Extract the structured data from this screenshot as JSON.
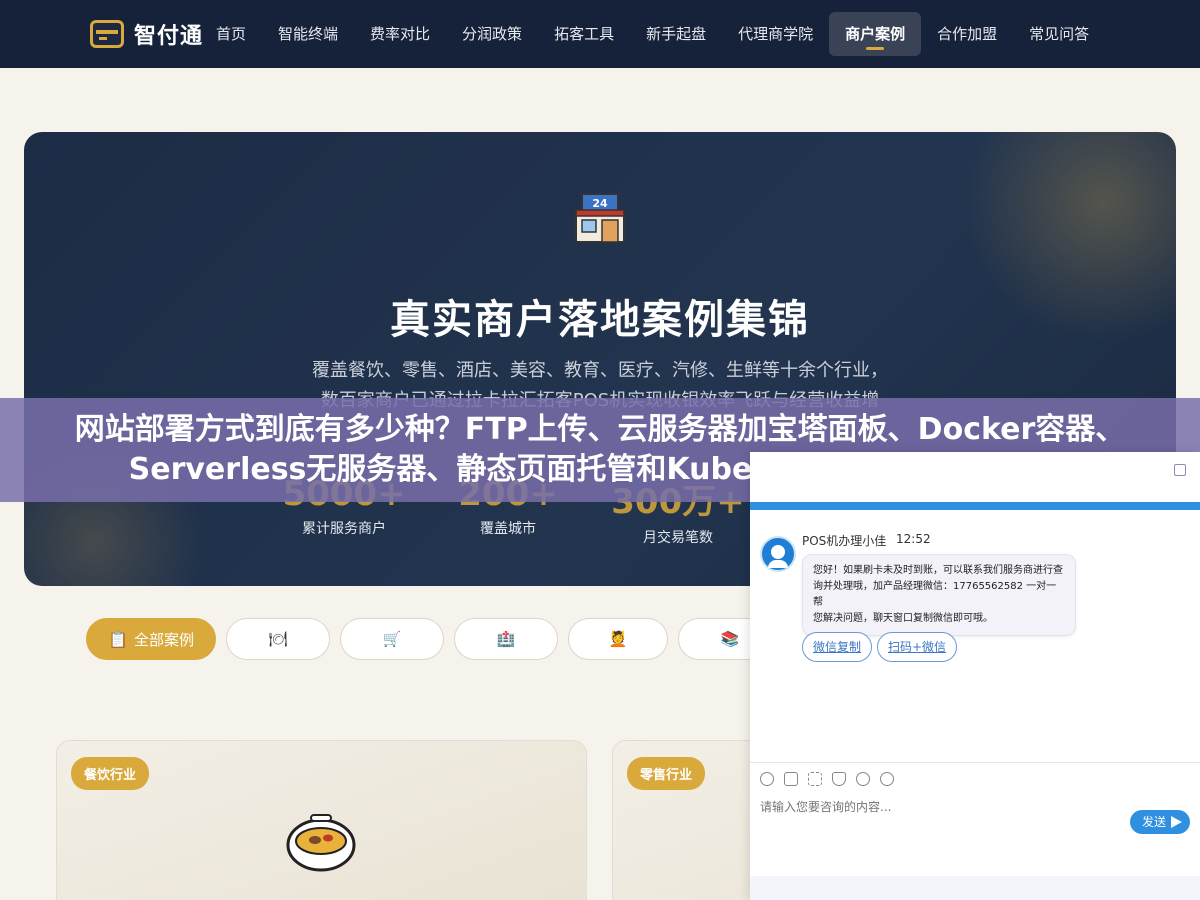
{
  "nav": {
    "brand": "智付通",
    "items": [
      "首页",
      "智能终端",
      "费率对比",
      "分润政策",
      "拓客工具",
      "新手起盘",
      "代理商学院",
      "商户案例",
      "合作加盟",
      "常见问答"
    ],
    "active": "商户案例"
  },
  "hero": {
    "icon": "convenience-store-icon",
    "title": "真实商户落地案例集锦",
    "desc_line1": "覆盖餐饮、零售、酒店、美容、教育、医疗、汽修、生鲜等十余个行业，",
    "desc_line2": "数百家商户已通过拉卡拉汇拓客POS机实现收银效率飞跃与经营收益增",
    "stats": [
      {
        "value": "5000+",
        "label": "累计服务商户"
      },
      {
        "value": "200+",
        "label": "覆盖城市"
      },
      {
        "value": "300万+",
        "label": "月交易笔数"
      }
    ]
  },
  "banner": {
    "text": "网站部署方式到底有多少种？FTP上传、云服务器加宝塔面板、Docker容器、Serverless无服务器、静态页面托管和Kubernetes这六种从省事到"
  },
  "filters": {
    "all_label": "全部案例",
    "all_icon": "clipboard-icon",
    "icons": [
      "dining-icon",
      "cart-icon",
      "hospital-icon",
      "beauty-icon",
      "books-icon"
    ]
  },
  "cards": [
    {
      "tag": "餐饮行业",
      "icon": "food-bowl-icon"
    },
    {
      "tag": "零售行业",
      "icon": ""
    }
  ],
  "chat": {
    "agent_name": "POS机办理小佳",
    "time": "12:52",
    "message_line1": "您好！如果刷卡未及时到账，可以联系我们服务商进行查",
    "message_line2": "询并处理哦，加产品经理微信：17765562582 一对一帮",
    "message_line3": "您解决问题，聊天窗口复制微信即可哦。",
    "quick_replies": [
      "微信复制",
      "扫码+微信"
    ],
    "input_placeholder": "请输入您要咨询的内容...",
    "send_label": "发送",
    "colors": {
      "accent": "#2f8fe0"
    }
  },
  "colors": {
    "gold": "#d9a93c",
    "navy": "#16213a"
  }
}
